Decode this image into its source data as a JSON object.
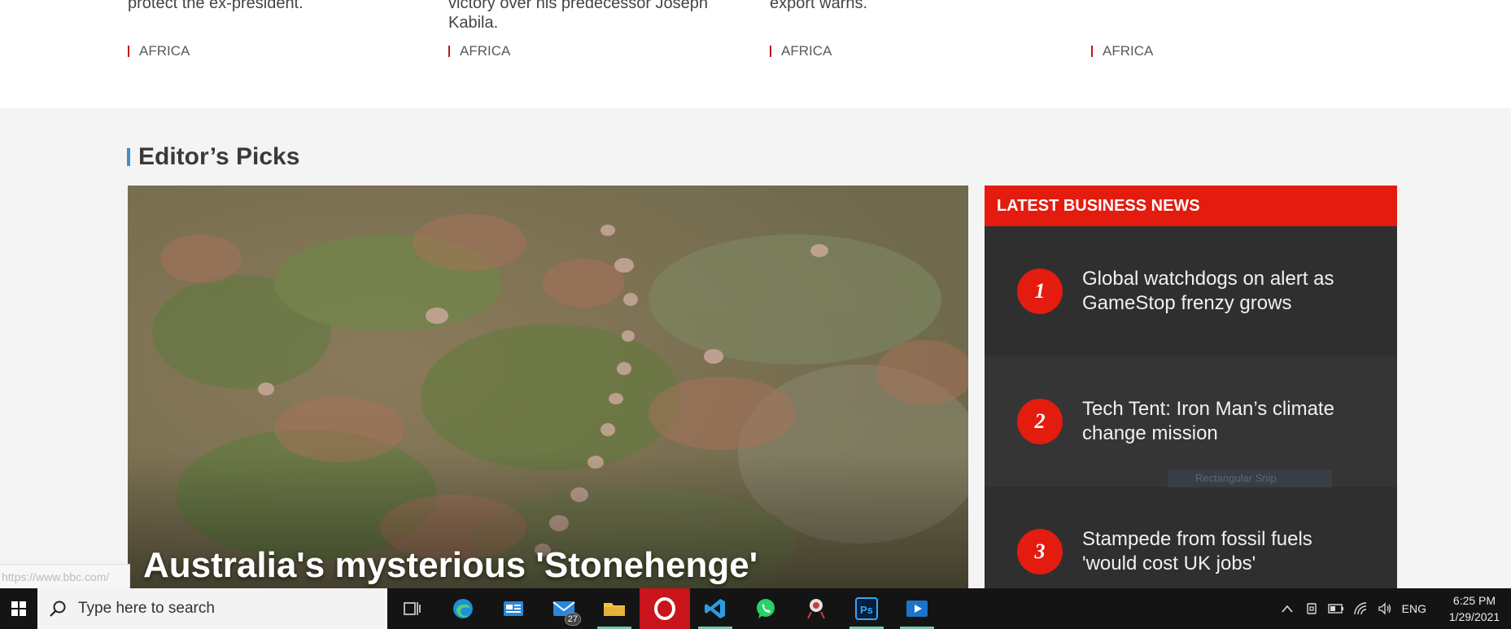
{
  "top_stories": [
    {
      "text": "protect the ex-president.",
      "tag": "AFRICA"
    },
    {
      "text": "victory over his predecessor Joseph Kabila.",
      "tag": "AFRICA"
    },
    {
      "text": "export warns.",
      "tag": "AFRICA"
    },
    {
      "text": "",
      "tag": "AFRICA"
    }
  ],
  "editors_picks": {
    "title": "Editor’s Picks",
    "hero_title": "Australia's mysterious 'Stonehenge'"
  },
  "business_news": {
    "header": "LATEST BUSINESS NEWS",
    "items": [
      {
        "num": "1",
        "title": "Global watchdogs on alert as GameStop frenzy grows"
      },
      {
        "num": "2",
        "title": "Tech Tent: Iron Man’s climate change mission"
      },
      {
        "num": "3",
        "title": "Stampede from fossil fuels 'would cost UK jobs'"
      }
    ]
  },
  "overlays": {
    "snip_label": "Rectangular Snip",
    "status_url": "https://www.bbc.com/"
  },
  "taskbar": {
    "search_placeholder": "Type here to search",
    "mail_badge": "27",
    "language": "ENG",
    "time": "6:25 PM",
    "date": "1/29/2021"
  },
  "colors": {
    "accent_red": "#e41b0f",
    "section_blue": "#3e8ec9",
    "panel_dark": "#2f2f2f"
  }
}
